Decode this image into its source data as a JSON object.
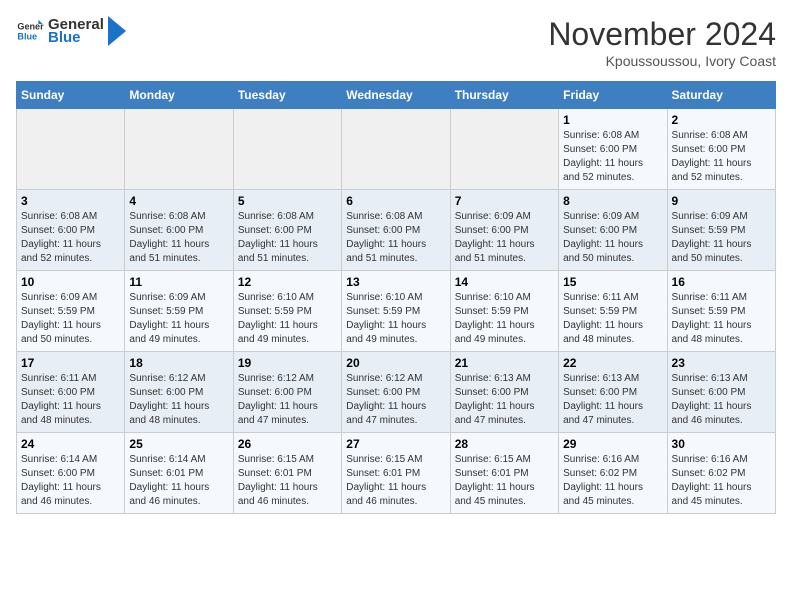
{
  "header": {
    "logo_line1": "General",
    "logo_line2": "Blue",
    "month_title": "November 2024",
    "location": "Kpoussoussou, Ivory Coast"
  },
  "weekdays": [
    "Sunday",
    "Monday",
    "Tuesday",
    "Wednesday",
    "Thursday",
    "Friday",
    "Saturday"
  ],
  "weeks": [
    [
      {
        "day": "",
        "info": ""
      },
      {
        "day": "",
        "info": ""
      },
      {
        "day": "",
        "info": ""
      },
      {
        "day": "",
        "info": ""
      },
      {
        "day": "",
        "info": ""
      },
      {
        "day": "1",
        "info": "Sunrise: 6:08 AM\nSunset: 6:00 PM\nDaylight: 11 hours\nand 52 minutes."
      },
      {
        "day": "2",
        "info": "Sunrise: 6:08 AM\nSunset: 6:00 PM\nDaylight: 11 hours\nand 52 minutes."
      }
    ],
    [
      {
        "day": "3",
        "info": "Sunrise: 6:08 AM\nSunset: 6:00 PM\nDaylight: 11 hours\nand 52 minutes."
      },
      {
        "day": "4",
        "info": "Sunrise: 6:08 AM\nSunset: 6:00 PM\nDaylight: 11 hours\nand 51 minutes."
      },
      {
        "day": "5",
        "info": "Sunrise: 6:08 AM\nSunset: 6:00 PM\nDaylight: 11 hours\nand 51 minutes."
      },
      {
        "day": "6",
        "info": "Sunrise: 6:08 AM\nSunset: 6:00 PM\nDaylight: 11 hours\nand 51 minutes."
      },
      {
        "day": "7",
        "info": "Sunrise: 6:09 AM\nSunset: 6:00 PM\nDaylight: 11 hours\nand 51 minutes."
      },
      {
        "day": "8",
        "info": "Sunrise: 6:09 AM\nSunset: 6:00 PM\nDaylight: 11 hours\nand 50 minutes."
      },
      {
        "day": "9",
        "info": "Sunrise: 6:09 AM\nSunset: 5:59 PM\nDaylight: 11 hours\nand 50 minutes."
      }
    ],
    [
      {
        "day": "10",
        "info": "Sunrise: 6:09 AM\nSunset: 5:59 PM\nDaylight: 11 hours\nand 50 minutes."
      },
      {
        "day": "11",
        "info": "Sunrise: 6:09 AM\nSunset: 5:59 PM\nDaylight: 11 hours\nand 49 minutes."
      },
      {
        "day": "12",
        "info": "Sunrise: 6:10 AM\nSunset: 5:59 PM\nDaylight: 11 hours\nand 49 minutes."
      },
      {
        "day": "13",
        "info": "Sunrise: 6:10 AM\nSunset: 5:59 PM\nDaylight: 11 hours\nand 49 minutes."
      },
      {
        "day": "14",
        "info": "Sunrise: 6:10 AM\nSunset: 5:59 PM\nDaylight: 11 hours\nand 49 minutes."
      },
      {
        "day": "15",
        "info": "Sunrise: 6:11 AM\nSunset: 5:59 PM\nDaylight: 11 hours\nand 48 minutes."
      },
      {
        "day": "16",
        "info": "Sunrise: 6:11 AM\nSunset: 5:59 PM\nDaylight: 11 hours\nand 48 minutes."
      }
    ],
    [
      {
        "day": "17",
        "info": "Sunrise: 6:11 AM\nSunset: 6:00 PM\nDaylight: 11 hours\nand 48 minutes."
      },
      {
        "day": "18",
        "info": "Sunrise: 6:12 AM\nSunset: 6:00 PM\nDaylight: 11 hours\nand 48 minutes."
      },
      {
        "day": "19",
        "info": "Sunrise: 6:12 AM\nSunset: 6:00 PM\nDaylight: 11 hours\nand 47 minutes."
      },
      {
        "day": "20",
        "info": "Sunrise: 6:12 AM\nSunset: 6:00 PM\nDaylight: 11 hours\nand 47 minutes."
      },
      {
        "day": "21",
        "info": "Sunrise: 6:13 AM\nSunset: 6:00 PM\nDaylight: 11 hours\nand 47 minutes."
      },
      {
        "day": "22",
        "info": "Sunrise: 6:13 AM\nSunset: 6:00 PM\nDaylight: 11 hours\nand 47 minutes."
      },
      {
        "day": "23",
        "info": "Sunrise: 6:13 AM\nSunset: 6:00 PM\nDaylight: 11 hours\nand 46 minutes."
      }
    ],
    [
      {
        "day": "24",
        "info": "Sunrise: 6:14 AM\nSunset: 6:00 PM\nDaylight: 11 hours\nand 46 minutes."
      },
      {
        "day": "25",
        "info": "Sunrise: 6:14 AM\nSunset: 6:01 PM\nDaylight: 11 hours\nand 46 minutes."
      },
      {
        "day": "26",
        "info": "Sunrise: 6:15 AM\nSunset: 6:01 PM\nDaylight: 11 hours\nand 46 minutes."
      },
      {
        "day": "27",
        "info": "Sunrise: 6:15 AM\nSunset: 6:01 PM\nDaylight: 11 hours\nand 46 minutes."
      },
      {
        "day": "28",
        "info": "Sunrise: 6:15 AM\nSunset: 6:01 PM\nDaylight: 11 hours\nand 45 minutes."
      },
      {
        "day": "29",
        "info": "Sunrise: 6:16 AM\nSunset: 6:02 PM\nDaylight: 11 hours\nand 45 minutes."
      },
      {
        "day": "30",
        "info": "Sunrise: 6:16 AM\nSunset: 6:02 PM\nDaylight: 11 hours\nand 45 minutes."
      }
    ]
  ]
}
